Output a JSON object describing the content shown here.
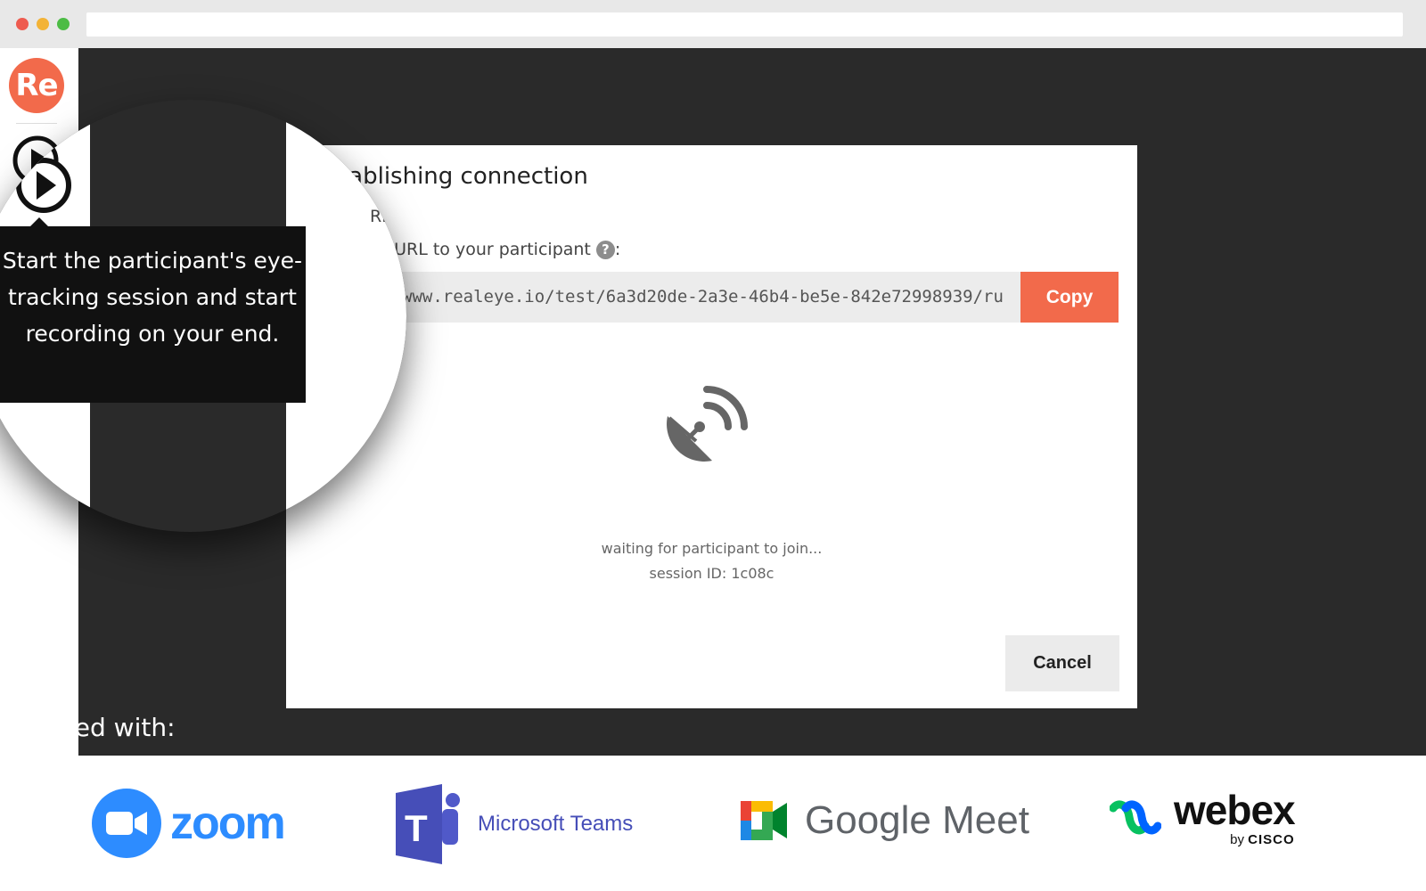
{
  "app": {
    "logo_text": "Re",
    "brand_color": "#f26a4b",
    "background_color": "#2a2a2a"
  },
  "tooltip": {
    "text": "Start the participant's eye-tracking session and start recording on your end."
  },
  "dialog": {
    "title": "Establishing connection",
    "visible_title_fragment": "blishing connection",
    "url_label": "Send the URL to your participant",
    "visible_url_label_fragment": "RL to your participant",
    "label_suffix": ":",
    "url_value": "www.realeye.io/test/6a3d20de-2a3e-46b4-be5e-842e72998939/ru",
    "copy_label": "Copy",
    "status_text": "waiting for participant to join...",
    "session_text": "session ID: 1c08c",
    "cancel_label": "Cancel",
    "icon": "satellite-dish-icon"
  },
  "tested_with": {
    "label": "tested with:",
    "logos": [
      {
        "name": "zoom",
        "text": "zoom",
        "color": "#2d8cff"
      },
      {
        "name": "microsoft-teams",
        "text": "Microsoft Teams",
        "color": "#464eb8"
      },
      {
        "name": "google-meet",
        "text": "Google Meet",
        "color": "#5f6368"
      },
      {
        "name": "webex",
        "text": "webex",
        "sub_prefix": "by",
        "sub_brand": "CISCO",
        "color": "#111111"
      }
    ]
  }
}
